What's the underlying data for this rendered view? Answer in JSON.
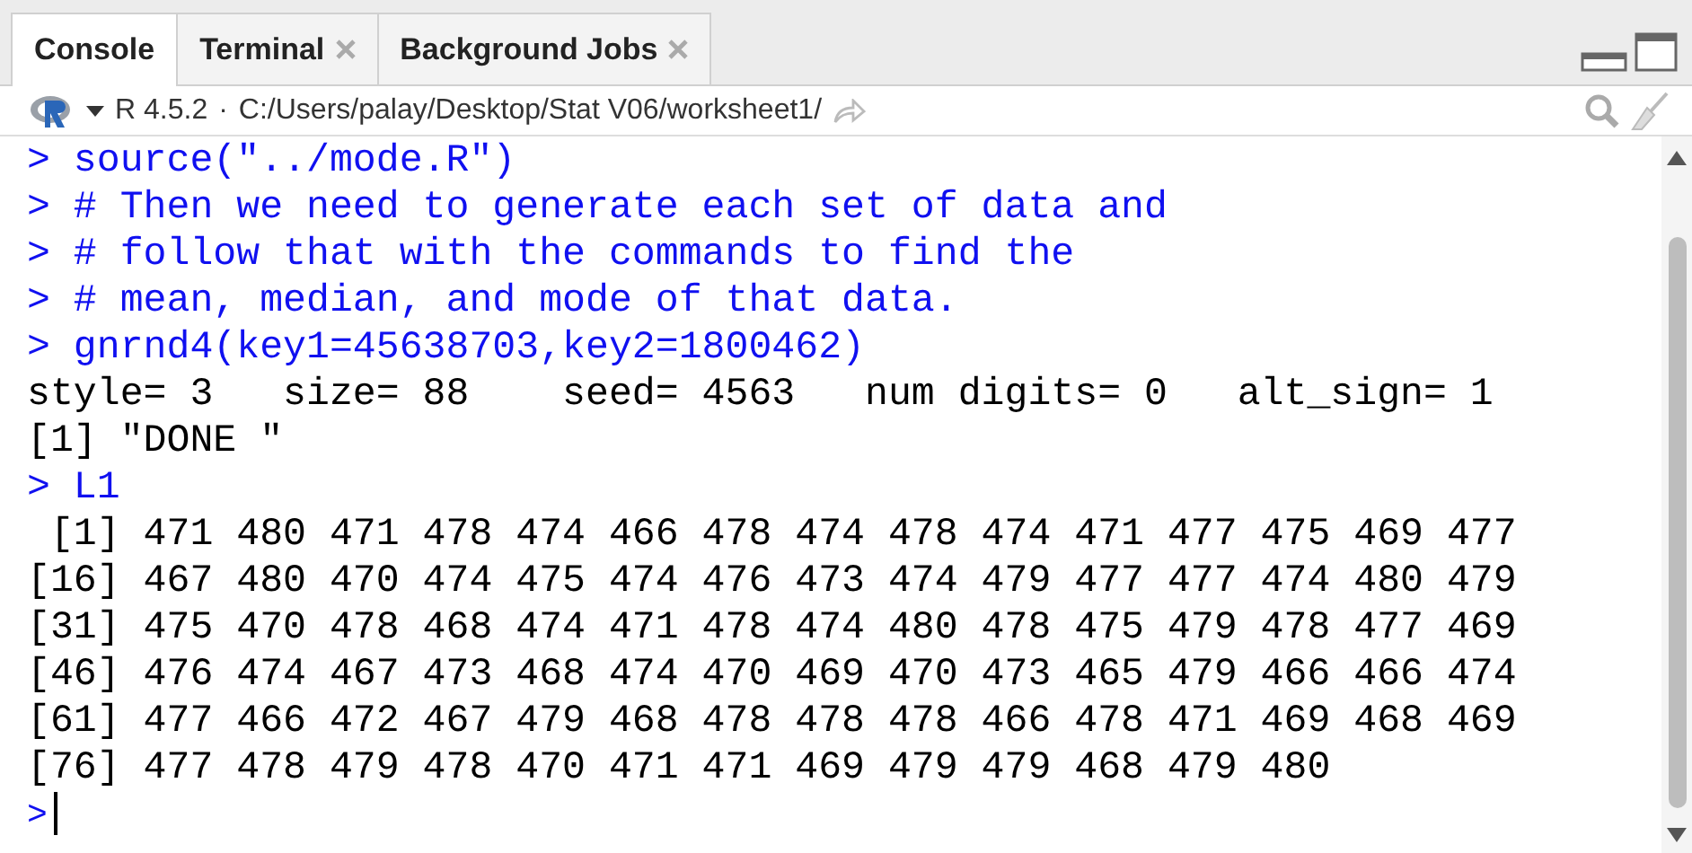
{
  "tabs": [
    {
      "label": "Console",
      "selected": true,
      "closable": false
    },
    {
      "label": "Terminal",
      "selected": false,
      "closable": true
    },
    {
      "label": "Background Jobs",
      "selected": false,
      "closable": true
    }
  ],
  "toolbar": {
    "version": "R 4.5.2",
    "separator": "·",
    "path": "C:/Users/palay/Desktop/Stat V06/worksheet1/"
  },
  "console": {
    "lines": [
      {
        "kind": "input",
        "text": "> source(\"../mode.R\")"
      },
      {
        "kind": "input",
        "text": "> # Then we need to generate each set of data and"
      },
      {
        "kind": "input",
        "text": "> # follow that with the commands to find the"
      },
      {
        "kind": "input",
        "text": "> # mean, median, and mode of that data."
      },
      {
        "kind": "input",
        "text": "> gnrnd4(key1=45638703,key2=1800462)"
      },
      {
        "kind": "output",
        "text": "style= 3   size= 88    seed= 4563   num digits= 0   alt_sign= 1"
      },
      {
        "kind": "output",
        "text": "[1] \"DONE \""
      },
      {
        "kind": "input",
        "text": "> L1"
      },
      {
        "kind": "output",
        "text": " [1] 471 480 471 478 474 466 478 474 478 474 471 477 475 469 477"
      },
      {
        "kind": "output",
        "text": "[16] 467 480 470 474 475 474 476 473 474 479 477 477 474 480 479"
      },
      {
        "kind": "output",
        "text": "[31] 475 470 478 468 474 471 478 474 480 478 475 479 478 477 469"
      },
      {
        "kind": "output",
        "text": "[46] 476 474 467 473 468 474 470 469 470 473 465 479 466 466 474"
      },
      {
        "kind": "output",
        "text": "[61] 477 466 472 467 479 468 478 478 478 466 478 471 469 468 469"
      },
      {
        "kind": "output",
        "text": "[76] 477 478 479 478 470 471 471 469 479 479 468 479 480"
      }
    ],
    "prompt": ">"
  }
}
